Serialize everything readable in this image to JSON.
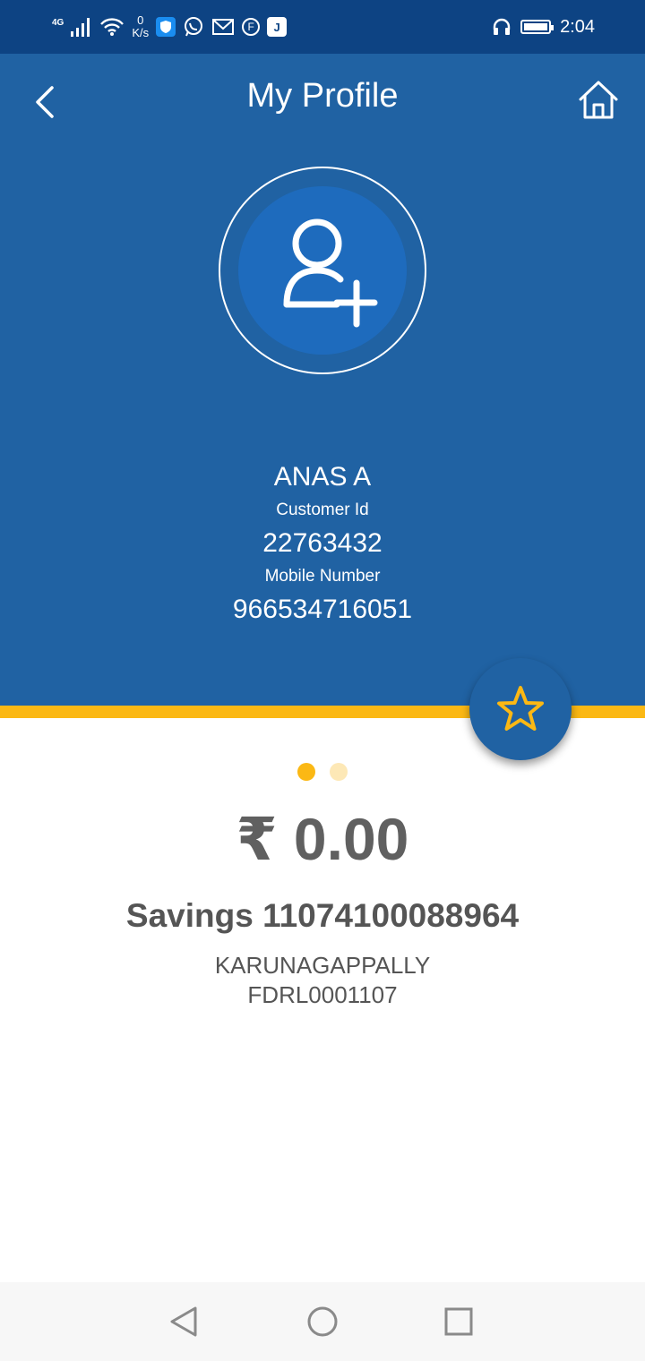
{
  "status_bar": {
    "network_type": "4G",
    "speed_value": "0",
    "speed_unit": "K/s",
    "notif_f": "F",
    "notif_j": "J",
    "time": "2:04"
  },
  "header": {
    "title": "My Profile"
  },
  "profile": {
    "name": "ANAS A",
    "customer_id_label": "Customer Id",
    "customer_id": "22763432",
    "mobile_label": "Mobile Number",
    "mobile": "966534716051"
  },
  "carousel": {
    "page_count": 2,
    "active_index": 0
  },
  "account": {
    "balance": "₹ 0.00",
    "account_line": "Savings 11074100088964",
    "branch": "KARUNAGAPPALLY",
    "ifsc": "FDRL0001107"
  },
  "colors": {
    "status_bar": "#0d4383",
    "header_blue": "#2062a3",
    "avatar_blue": "#1e6bbd",
    "accent_yellow": "#fbb814",
    "text_gray": "#555555"
  },
  "icons": {
    "back": "chevron-left-icon",
    "home": "home-icon",
    "avatar": "add-user-icon",
    "favorite": "star-icon",
    "nav_back": "triangle-back-icon",
    "nav_home": "circle-home-icon",
    "nav_recents": "square-recents-icon"
  }
}
